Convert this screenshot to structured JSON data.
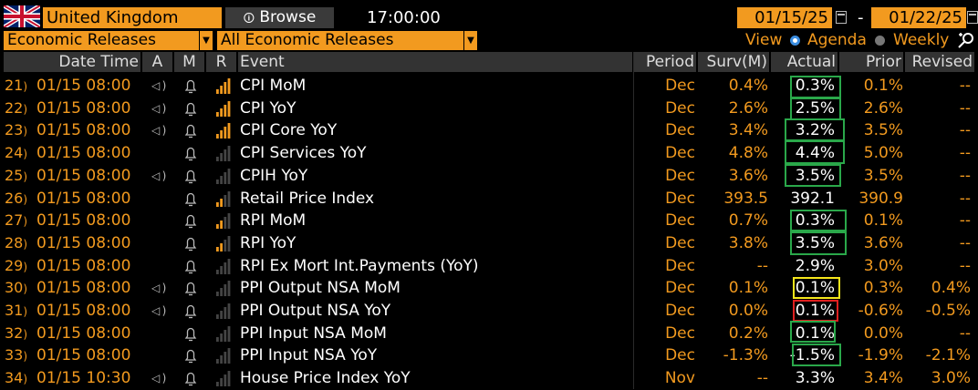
{
  "toolbar": {
    "country": "United Kingdom",
    "browse_label": "Browse",
    "time": "17:00:00",
    "date_from": "01/15/25",
    "date_to": "01/22/25",
    "dash": "-"
  },
  "filters": {
    "category": "Economic Releases",
    "subcategory": "All Economic Releases",
    "view_label": "View",
    "agenda_label": "Agenda",
    "weekly_label": "Weekly",
    "selected_view": "Agenda"
  },
  "columns": {
    "datetime": "Date Time",
    "a": "A",
    "m": "M",
    "r": "R",
    "event": "Event",
    "period": "Period",
    "surv": "Surv(M)",
    "actual": "Actual",
    "prior": "Prior",
    "revised": "Revised"
  },
  "colors": {
    "orange": "#f29a1f",
    "green_box": "#2aa84a",
    "yellow_box": "#f5e51b",
    "red_box": "#e02020"
  },
  "rows": [
    {
      "num": "21",
      "datetime": "01/15 08:00",
      "alert": true,
      "relevance": 4,
      "event": "CPI MoM",
      "period": "Dec",
      "surv": "0.4%",
      "actual": "0.3%",
      "prior": "0.1%",
      "revised": "--",
      "box": "green"
    },
    {
      "num": "22",
      "datetime": "01/15 08:00",
      "alert": true,
      "relevance": 4,
      "event": "CPI YoY",
      "period": "Dec",
      "surv": "2.6%",
      "actual": "2.5%",
      "prior": "2.6%",
      "revised": "--",
      "box": "green"
    },
    {
      "num": "23",
      "datetime": "01/15 08:00",
      "alert": true,
      "relevance": 4,
      "event": "CPI Core YoY",
      "period": "Dec",
      "surv": "3.4%",
      "actual": "3.2%",
      "prior": "3.5%",
      "revised": "--",
      "box": "green"
    },
    {
      "num": "24",
      "datetime": "01/15 08:00",
      "alert": false,
      "relevance": 0,
      "event": "CPI Services YoY",
      "period": "Dec",
      "surv": "4.8%",
      "actual": "4.4%",
      "prior": "5.0%",
      "revised": "--",
      "box": "green"
    },
    {
      "num": "25",
      "datetime": "01/15 08:00",
      "alert": true,
      "relevance": 0,
      "event": "CPIH YoY",
      "period": "Dec",
      "surv": "3.6%",
      "actual": "3.5%",
      "prior": "3.5%",
      "revised": "--",
      "box": "green"
    },
    {
      "num": "26",
      "datetime": "01/15 08:00",
      "alert": false,
      "relevance": 2,
      "event": "Retail Price Index",
      "period": "Dec",
      "surv": "393.5",
      "actual": "392.1",
      "prior": "390.9",
      "revised": "--",
      "box": ""
    },
    {
      "num": "27",
      "datetime": "01/15 08:00",
      "alert": false,
      "relevance": 2,
      "event": "RPI MoM",
      "period": "Dec",
      "surv": "0.7%",
      "actual": "0.3%",
      "prior": "0.1%",
      "revised": "--",
      "box": "green"
    },
    {
      "num": "28",
      "datetime": "01/15 08:00",
      "alert": false,
      "relevance": 2,
      "event": "RPI YoY",
      "period": "Dec",
      "surv": "3.8%",
      "actual": "3.5%",
      "prior": "3.6%",
      "revised": "--",
      "box": "green"
    },
    {
      "num": "29",
      "datetime": "01/15 08:00",
      "alert": false,
      "relevance": 0,
      "event": "RPI Ex Mort Int.Payments (YoY)",
      "period": "Dec",
      "surv": "--",
      "actual": "2.9%",
      "prior": "3.0%",
      "revised": "--",
      "box": ""
    },
    {
      "num": "30",
      "datetime": "01/15 08:00",
      "alert": true,
      "relevance": 0,
      "event": "PPI Output NSA MoM",
      "period": "Dec",
      "surv": "0.1%",
      "actual": "0.1%",
      "prior": "0.3%",
      "revised": "0.4%",
      "box": "yellow"
    },
    {
      "num": "31",
      "datetime": "01/15 08:00",
      "alert": true,
      "relevance": 0,
      "event": "PPI Output NSA YoY",
      "period": "Dec",
      "surv": "0.0%",
      "actual": "0.1%",
      "prior": "-0.6%",
      "revised": "-0.5%",
      "box": "red"
    },
    {
      "num": "32",
      "datetime": "01/15 08:00",
      "alert": false,
      "relevance": 0,
      "event": "PPI Input NSA MoM",
      "period": "Dec",
      "surv": "0.2%",
      "actual": "0.1%",
      "prior": "0.0%",
      "revised": "--",
      "box": "green"
    },
    {
      "num": "33",
      "datetime": "01/15 08:00",
      "alert": false,
      "relevance": 0,
      "event": "PPI Input NSA YoY",
      "period": "Dec",
      "surv": "-1.3%",
      "actual": "-1.5%",
      "prior": "-1.9%",
      "revised": "-2.1%",
      "box": "green"
    },
    {
      "num": "34",
      "datetime": "01/15 10:30",
      "alert": true,
      "relevance": 0,
      "event": "House Price Index YoY",
      "period": "Nov",
      "surv": "--",
      "actual": "3.3%",
      "prior": "3.4%",
      "revised": "3.0%",
      "box": ""
    }
  ]
}
